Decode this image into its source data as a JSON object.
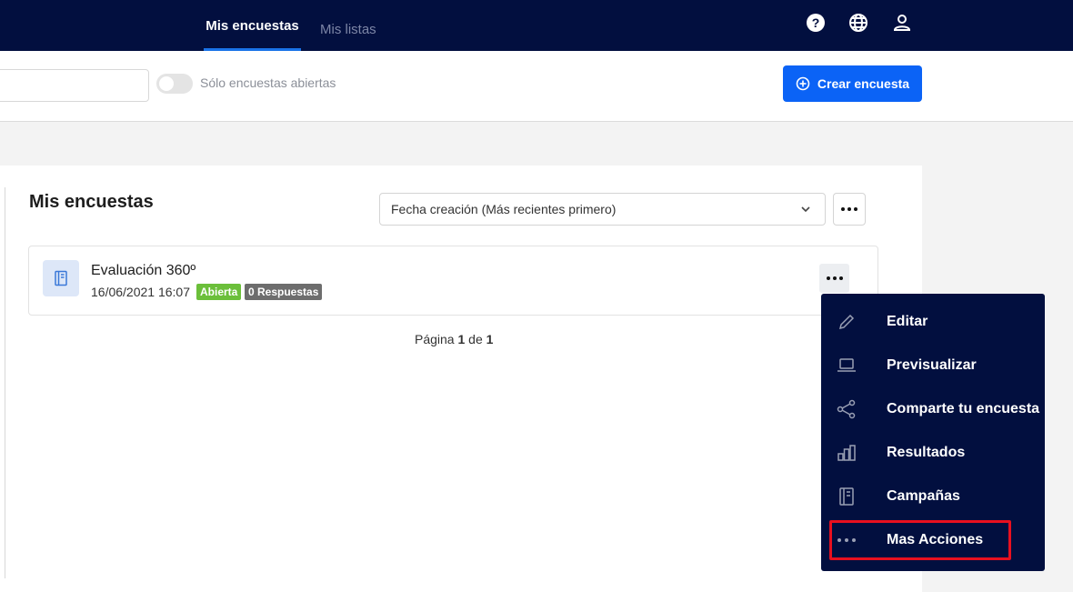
{
  "nav": {
    "tabs": [
      {
        "label": "Mis encuestas",
        "active": true
      },
      {
        "label": "Mis listas",
        "active": false
      }
    ],
    "icons": [
      "help-icon",
      "globe-icon",
      "user-icon"
    ]
  },
  "filters": {
    "search_placeholder": "",
    "toggle_label": "Sólo encuestas abiertas",
    "toggle_on": false,
    "create_label": "Crear encuesta"
  },
  "main": {
    "title": "Mis encuestas",
    "sort_value": "Fecha creación (Más recientes primero)",
    "surveys": [
      {
        "name": "Evaluación 360º",
        "date": "16/06/2021 16:07",
        "status": "Abierta",
        "responses": "0 Respuestas"
      }
    ],
    "pagination": {
      "prefix": "Página",
      "current": "1",
      "sep": "de",
      "total": "1"
    }
  },
  "menu": {
    "items": [
      {
        "label": "Editar",
        "icon": "pencil-icon"
      },
      {
        "label": "Previsualizar",
        "icon": "laptop-icon"
      },
      {
        "label": "Comparte tu encuesta",
        "icon": "share-icon"
      },
      {
        "label": "Resultados",
        "icon": "bar-chart-icon"
      },
      {
        "label": "Campañas",
        "icon": "notebook-icon"
      },
      {
        "label": "Mas Acciones",
        "icon": "more-icon"
      }
    ],
    "highlighted": "Mas Acciones"
  },
  "colors": {
    "nav_bg": "#020f3f",
    "accent": "#0b63f6",
    "badge_open": "#6bbf3a",
    "badge_responses": "#6d6d6d",
    "highlight": "#e8101f"
  }
}
